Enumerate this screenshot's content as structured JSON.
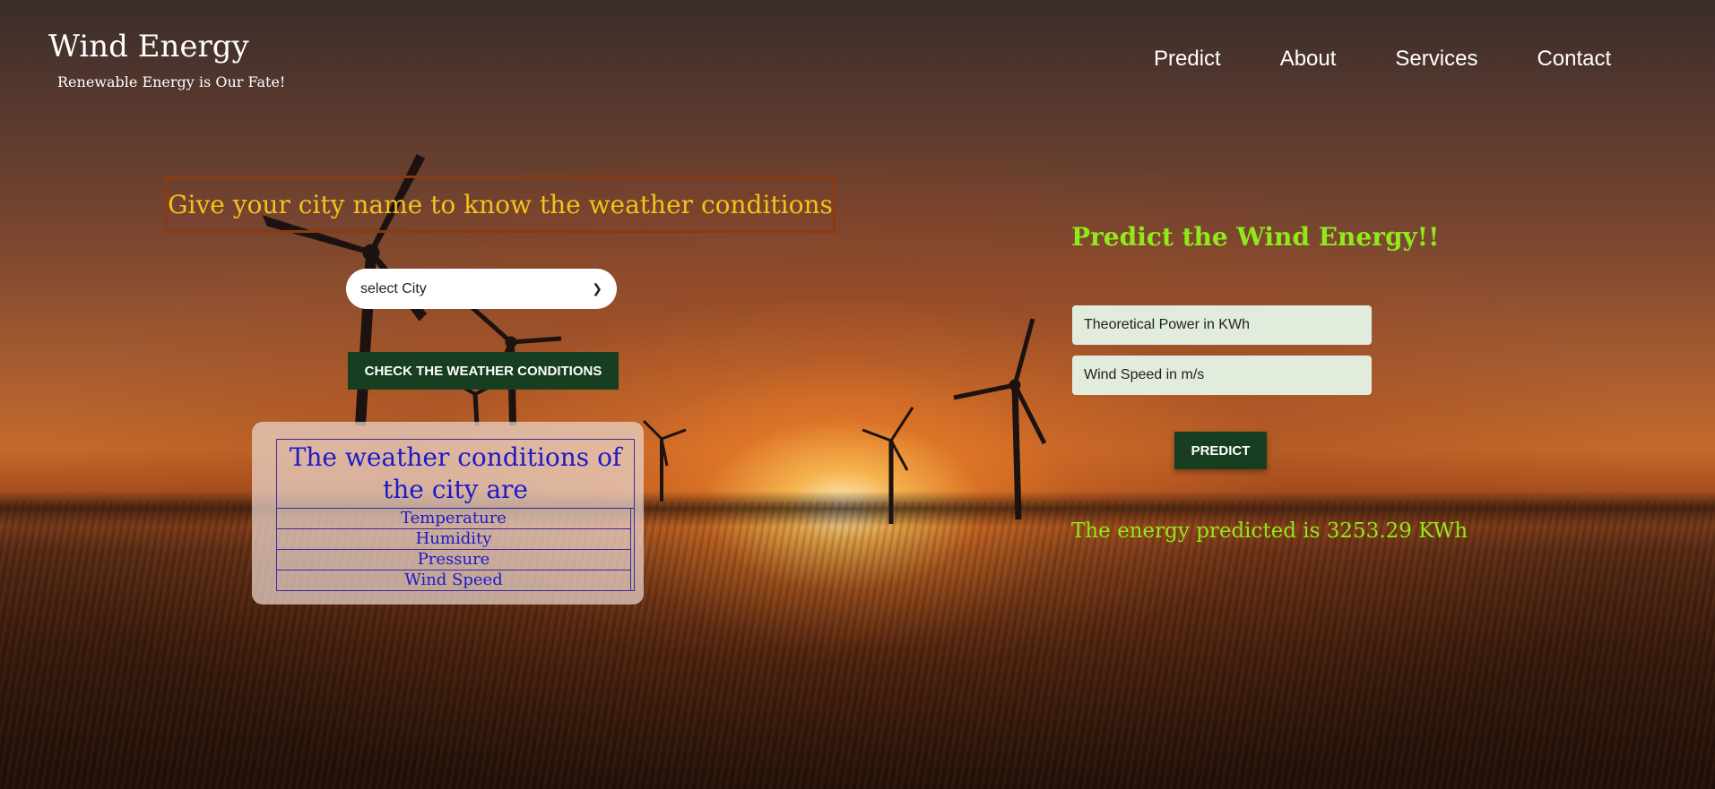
{
  "header": {
    "brand_title": "Wind Energy",
    "tagline": "Renewable Energy is Our Fate!",
    "nav": [
      "Predict",
      "About",
      "Services",
      "Contact"
    ]
  },
  "weather": {
    "heading": "Give your city name to know the weather conditions",
    "select_value": "select City",
    "check_button": "CHECK THE WEATHER CONDITIONS",
    "table_title": "The weather conditions of the city are",
    "rows": [
      "Temperature",
      "Humidity",
      "Pressure",
      "Wind Speed"
    ]
  },
  "prediction": {
    "title": "Predict the Wind Energy!!",
    "power_placeholder": "Theoretical Power in KWh",
    "speed_placeholder": "Wind Speed in m/s",
    "predict_button": "PREDICT",
    "result_text": "The energy predicted is 3253.29 KWh"
  },
  "colors": {
    "accent_yellow": "#f5c21a",
    "accent_green": "#8fea1a",
    "button_green": "#173e20",
    "weather_text": "#1a1acc"
  }
}
